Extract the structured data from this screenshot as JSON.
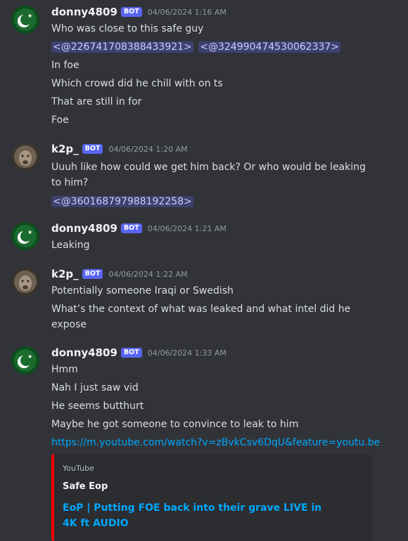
{
  "messages": [
    {
      "author": "donny4809",
      "tag": "BOT",
      "timestamp": "04/06/2024 1:16 AM",
      "avatar": "green-flag-avatar",
      "lines": [
        "Who was close to this safe guy",
        null,
        "In foe",
        "Which crowd did he chill with on ts",
        "That are still in for",
        "Foe"
      ],
      "mentions": [
        "<@226741708388433921>",
        "<@324990474530062337>"
      ]
    },
    {
      "author": "k2p_",
      "tag": "BOT",
      "timestamp": "04/06/2024 1:20 AM",
      "avatar": "lion-avatar",
      "lines": [
        "Uuuh like how could we get him back? Or who would be leaking to him?"
      ],
      "mentions": [
        "<@360168797988192258>"
      ]
    },
    {
      "author": "donny4809",
      "tag": "BOT",
      "timestamp": "04/06/2024 1:21 AM",
      "avatar": "green-flag-avatar",
      "lines": [
        "Leaking"
      ]
    },
    {
      "author": "k2p_",
      "tag": "BOT",
      "timestamp": "04/06/2024 1:22 AM",
      "avatar": "lion-avatar",
      "lines": [
        "Potentially someone Iraqi or Swedish",
        "What’s the context of what was leaked and what intel did he expose"
      ]
    },
    {
      "author": "donny4809",
      "tag": "BOT",
      "timestamp": "04/06/2024 1:33 AM",
      "avatar": "green-flag-avatar",
      "lines": [
        "Hmm",
        "Nah I just saw vid",
        "He seems butthurt",
        "Maybe he got someone to convince to leak to him"
      ],
      "link": "https://m.youtube.com/watch?v=zBvkCsv6DqU&feature=youtu.be",
      "embed": {
        "provider": "YouTube",
        "author": "Safe Eop",
        "title": "EoP | Putting FOE back into their grave LIVE in 4K ft AUDIO",
        "color": "#ff0000"
      }
    }
  ],
  "colors": {
    "background": "#313338",
    "bot_tag": "#5865f2",
    "link": "#00a8fc",
    "mention_bg": "#3c4270"
  }
}
